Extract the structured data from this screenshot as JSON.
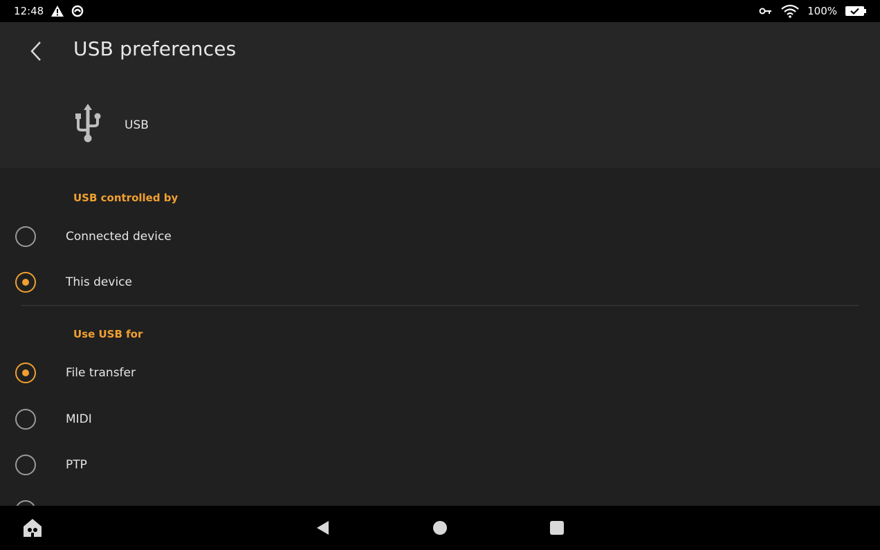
{
  "status_bar": {
    "time": "12:48",
    "battery_percent": "100%",
    "icons": [
      "alert-icon",
      "sync-icon",
      "vpn-key-icon",
      "wifi-icon",
      "battery-icon"
    ]
  },
  "app_bar": {
    "title": "USB preferences",
    "device_label": "USB"
  },
  "sections": {
    "controlled_by": {
      "header": "USB controlled by",
      "options": [
        {
          "label": "Connected device",
          "checked": false
        },
        {
          "label": "This device",
          "checked": true
        }
      ]
    },
    "use_for": {
      "header": "Use USB for",
      "options": [
        {
          "label": "File transfer",
          "checked": true
        },
        {
          "label": "MIDI",
          "checked": false
        },
        {
          "label": "PTP",
          "checked": false
        }
      ]
    }
  },
  "nav_bar": {
    "icons": [
      "kids-home-icon",
      "back-icon",
      "home-icon",
      "recents-icon"
    ]
  },
  "colors": {
    "accent": "#f0a030",
    "background": "#202020",
    "header_background": "#262626"
  }
}
